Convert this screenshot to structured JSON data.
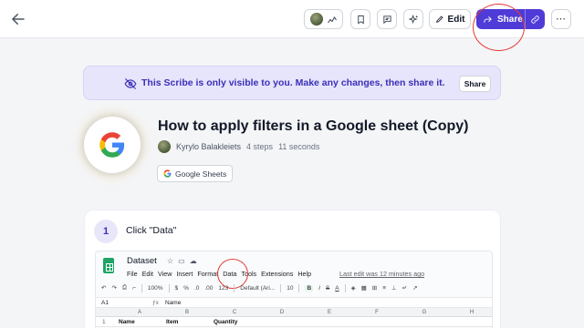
{
  "topbar": {
    "back_icon": "arrow-left-icon",
    "edit_label": "Edit",
    "share_label": "Share",
    "accent_color": "#4f3bd8"
  },
  "banner": {
    "text": "This Scribe is only visible to you. Make any changes, then share it.",
    "share_label": "Share"
  },
  "header": {
    "title": "How to apply filters in a Google sheet (Copy)",
    "author": "Kyrylo Balakleiets",
    "steps": "4 steps",
    "duration": "11 seconds",
    "app_chip": "Google Sheets"
  },
  "step": {
    "number": "1",
    "text": "Click \"Data\"",
    "screenshot": {
      "doc_name": "Dataset",
      "menu": [
        "File",
        "Edit",
        "View",
        "Insert",
        "Format",
        "Data",
        "Tools",
        "Extensions",
        "Help"
      ],
      "last_edit": "Last edit was 12 minutes ago",
      "toolbar": [
        "100%",
        "$",
        "%",
        ".0",
        ".00",
        "123",
        "Default (Ari...",
        "10",
        "B",
        "I",
        "S",
        "A"
      ],
      "cell_ref": "A1",
      "formula_value": "Name",
      "columns": [
        "A",
        "B",
        "C",
        "D",
        "E",
        "F",
        "G",
        "H"
      ],
      "row1": {
        "num": "1",
        "a": "Name",
        "b": "Item",
        "c": "Quantity"
      }
    }
  }
}
